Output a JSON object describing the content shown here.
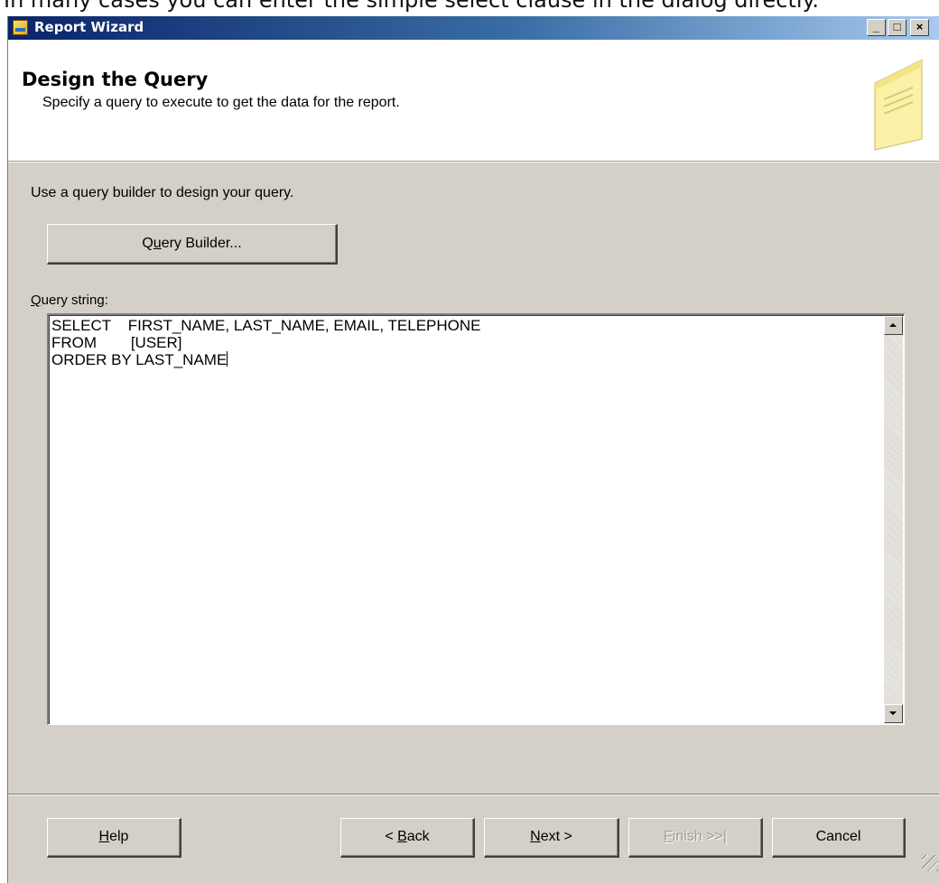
{
  "background_caption": "In many cases you can enter the simple select clause in the dialog directly.",
  "window": {
    "title": "Report Wizard",
    "controls": {
      "minimize": "_",
      "maximize": "□",
      "close": "×"
    }
  },
  "header": {
    "title": "Design the Query",
    "subtitle": "Specify a query to execute to get the data for the report.",
    "icon": "notepad-icon"
  },
  "body": {
    "instruction": "Use a query builder to design your query.",
    "query_builder_button": {
      "prefix": "Q",
      "mnemonic": "u",
      "suffix": "ery Builder..."
    },
    "query_label": {
      "mnemonic": "Q",
      "suffix": "uery string:"
    },
    "query_text": "SELECT    FIRST_NAME, LAST_NAME, EMAIL, TELEPHONE\nFROM        [USER]\nORDER BY LAST_NAME"
  },
  "footer": {
    "help": {
      "mnemonic": "H",
      "suffix": "elp"
    },
    "back": {
      "prefix": "< ",
      "mnemonic": "B",
      "suffix": "ack"
    },
    "next": {
      "prefix": "",
      "mnemonic": "N",
      "suffix": "ext >"
    },
    "finish": {
      "prefix": "",
      "mnemonic": "F",
      "suffix": "inish >>|",
      "enabled": false
    },
    "cancel": "Cancel"
  },
  "colors": {
    "dialog_bg": "#d4d0c8",
    "titlebar_start": "#0a246a",
    "titlebar_end": "#a6caf0"
  }
}
